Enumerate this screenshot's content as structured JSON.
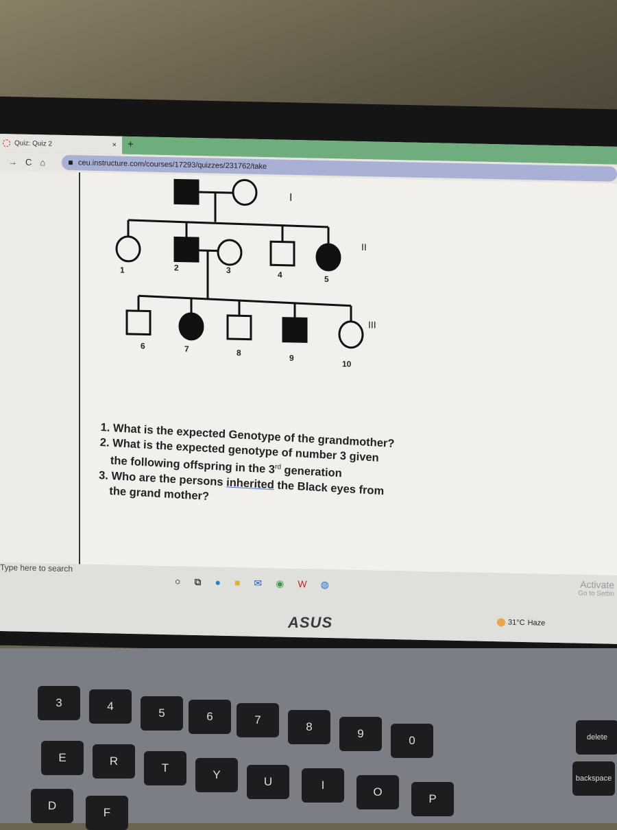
{
  "browser": {
    "tab_title": "Quiz: Quiz 2",
    "close": "×",
    "new_tab": "+",
    "back": "→",
    "reload": "C",
    "home": "⌂",
    "url": "ceu.instructure.com/courses/17293/quizzes/231762/take"
  },
  "pedigree": {
    "generations": [
      "I",
      "II",
      "III"
    ],
    "gen2": [
      "1",
      "2",
      "3",
      "4",
      "5"
    ],
    "gen3": [
      "6",
      "7",
      "8",
      "9",
      "10"
    ]
  },
  "questions": {
    "q1": "1. What is the expected Genotype of the grandmother?",
    "q2a": "2. What is the expected genotype of number 3 given",
    "q2b": "the following offspring in the 3",
    "q2sup": "rd",
    "q2c": " generation",
    "q3a": "3. Who are the persons ",
    "q3u": "inherited",
    "q3b": " the Black eyes from",
    "q3c": "the grand mother?"
  },
  "taskbar": {
    "search": "Type here to search",
    "activate": "Activate",
    "activate_sub": "Go to Settin",
    "temp": "31°C",
    "weather": "Haze",
    "icons": [
      "cortana-icon",
      "task-view-icon",
      "edge-icon",
      "file-explorer-icon",
      "mail-icon",
      "chrome-icon",
      "wps-icon",
      "other-app-icon"
    ]
  },
  "laptop": {
    "brand": "ASUS",
    "keys": [
      "3",
      "4",
      "5",
      "6",
      "7",
      "8",
      "9",
      "0",
      "E",
      "R",
      "T",
      "Y",
      "U",
      "I",
      "O",
      "P",
      "D",
      "F"
    ],
    "backspace": "backspace",
    "delete": "delete"
  },
  "colors": {
    "tab_bar": "#6fae7c",
    "omnibox": "#a9b0d6"
  }
}
